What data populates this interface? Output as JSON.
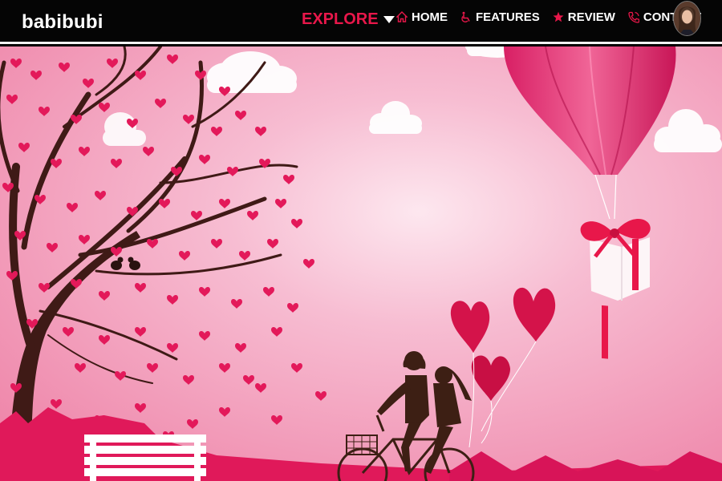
{
  "nav": {
    "brand": "babibubi",
    "explore_label": "EXPLORE",
    "items": [
      {
        "label": "HOME",
        "icon": "home-icon"
      },
      {
        "label": "FEATURES",
        "icon": "wheelchair-icon"
      },
      {
        "label": "REVIEW",
        "icon": "star-icon"
      },
      {
        "label": "CONTACT",
        "icon": "phone-icon"
      }
    ]
  },
  "colors": {
    "accent": "#e8174a",
    "nav_bg": "#050505",
    "hero_bg": "#f4a7c3",
    "heart": "#e3195a",
    "tree": "#4a1f1a"
  }
}
